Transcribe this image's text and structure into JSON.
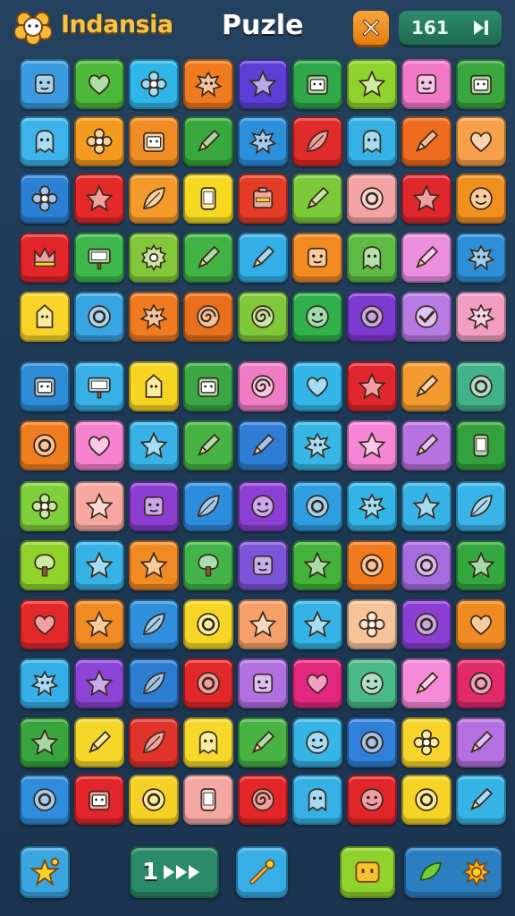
{
  "header": {
    "title_left": "Indansia",
    "title_center": "Puzle",
    "counter_value": "161",
    "logo_icon": "flower-badge-icon",
    "close_icon": "close-x-icon",
    "skip_icon": "skip-forward-icon"
  },
  "board": {
    "rows": [
      [
        [
          "#3a9be0",
          "square-face"
        ],
        [
          "#4cb83a",
          "heart"
        ],
        [
          "#2fb6e8",
          "flower"
        ],
        [
          "#f07a1f",
          "splat"
        ],
        [
          "#5b3fd6",
          "star"
        ],
        [
          "#2fa84a",
          "window-face"
        ],
        [
          "#8fd22c",
          "star"
        ],
        [
          "#f07ac8",
          "square-face"
        ],
        [
          "#39a63e",
          "window-face"
        ]
      ],
      [
        [
          "#3cb3ea",
          "ghost"
        ],
        [
          "#f39a1e",
          "flower"
        ],
        [
          "#f08c24",
          "window-face"
        ],
        [
          "#39a83c",
          "pencil"
        ],
        [
          "#2c8fdc",
          "splat"
        ],
        [
          "#e12a2a",
          "leaf"
        ],
        [
          "#35b1e6",
          "ghost"
        ],
        [
          "#ee6a1e",
          "pencil"
        ],
        [
          "#f7a04a",
          "heart"
        ]
      ],
      [
        [
          "#2c80d4",
          "flower"
        ],
        [
          "#e32a28",
          "star"
        ],
        [
          "#f49a2a",
          "leaf"
        ],
        [
          "#f7d921",
          "phone"
        ],
        [
          "#e33b25",
          "battery"
        ],
        [
          "#7cc93a",
          "pencil"
        ],
        [
          "#f4a3a3",
          "ring"
        ],
        [
          "#e0272d",
          "star"
        ],
        [
          "#f0901e",
          "face"
        ]
      ],
      [
        [
          "#e1252b",
          "crown"
        ],
        [
          "#3db94c",
          "sign"
        ],
        [
          "#82c83a",
          "gear"
        ],
        [
          "#41b445",
          "pencil"
        ],
        [
          "#34aee6",
          "pencil"
        ],
        [
          "#f28a22",
          "square-face"
        ],
        [
          "#5dbb44",
          "ghost"
        ],
        [
          "#ec8ee0",
          "pencil"
        ],
        [
          "#2e8fd8",
          "splat"
        ]
      ],
      [
        [
          "#f7d427",
          "tag"
        ],
        [
          "#39a4e2",
          "ring"
        ],
        [
          "#ef7a1f",
          "splat"
        ],
        [
          "#e8701d",
          "swirl"
        ],
        [
          "#7fc83a",
          "swirl"
        ],
        [
          "#2fb04a",
          "face"
        ],
        [
          "#7d3ad0",
          "ring"
        ],
        [
          "#b67be2",
          "check"
        ],
        [
          "#f29ec2",
          "splat"
        ]
      ],
      [
        [
          "#2e8cd8",
          "window-face"
        ],
        [
          "#36b0e6",
          "sign"
        ],
        [
          "#f6d422",
          "tag"
        ],
        [
          "#3ba744",
          "window-face"
        ],
        [
          "#f07cc6",
          "swirl"
        ],
        [
          "#32b6e8",
          "heart"
        ],
        [
          "#e2262e",
          "star"
        ],
        [
          "#f29a2e",
          "pencil"
        ],
        [
          "#42b28a",
          "ring"
        ]
      ],
      [
        [
          "#f07e20",
          "ring"
        ],
        [
          "#f482cf",
          "heart"
        ],
        [
          "#38b2e6",
          "star"
        ],
        [
          "#46b344",
          "pencil"
        ],
        [
          "#2f7ed6",
          "pencil"
        ],
        [
          "#36b6e4",
          "splat"
        ],
        [
          "#f685d6",
          "star"
        ],
        [
          "#b672e0",
          "pencil"
        ],
        [
          "#33a23e",
          "phone"
        ]
      ],
      [
        [
          "#7fcf3a",
          "flower"
        ],
        [
          "#f6a8a0",
          "star"
        ],
        [
          "#8b3ed0",
          "square-face"
        ],
        [
          "#2e8cdc",
          "leaf"
        ],
        [
          "#8b3fd3",
          "face"
        ],
        [
          "#2f9ee0",
          "ring"
        ],
        [
          "#33b4e6",
          "splat"
        ],
        [
          "#36b2e6",
          "star"
        ],
        [
          "#3ab4e8",
          "leaf"
        ]
      ],
      [
        [
          "#8fd22a",
          "tree"
        ],
        [
          "#36b2e6",
          "star"
        ],
        [
          "#f08a22",
          "star"
        ],
        [
          "#43b448",
          "tree"
        ],
        [
          "#7b54d8",
          "square-face"
        ],
        [
          "#43b23a",
          "star"
        ],
        [
          "#f07a1c",
          "ring"
        ],
        [
          "#a46ce0",
          "ring"
        ],
        [
          "#32a83e",
          "star"
        ]
      ],
      [
        [
          "#e3282c",
          "heart"
        ],
        [
          "#ef8a24",
          "star"
        ],
        [
          "#2f8fdc",
          "leaf"
        ],
        [
          "#f7d626",
          "ring"
        ],
        [
          "#f4a068",
          "star"
        ],
        [
          "#34b4e6",
          "star"
        ],
        [
          "#f6c39a",
          "flower"
        ],
        [
          "#8a3fd2",
          "ring"
        ],
        [
          "#ef8a22",
          "heart"
        ]
      ],
      [
        [
          "#35aee8",
          "splat"
        ],
        [
          "#8a44d6",
          "star"
        ],
        [
          "#2c7dd2",
          "leaf"
        ],
        [
          "#e2282a",
          "ring"
        ],
        [
          "#b070e0",
          "square-face"
        ],
        [
          "#e4277e",
          "heart"
        ],
        [
          "#49b98a",
          "face"
        ],
        [
          "#f58ad8",
          "pencil"
        ],
        [
          "#e02a6a",
          "ring"
        ]
      ],
      [
        [
          "#38a63c",
          "star"
        ],
        [
          "#f6d628",
          "pencil"
        ],
        [
          "#e0332a",
          "leaf"
        ],
        [
          "#f7d82a",
          "ghost"
        ],
        [
          "#48b343",
          "pencil"
        ],
        [
          "#36b4e6",
          "face"
        ],
        [
          "#2f80d8",
          "ring"
        ],
        [
          "#f6d42a",
          "flower"
        ],
        [
          "#b370e0",
          "pencil"
        ]
      ],
      [
        [
          "#2e8edc",
          "ring"
        ],
        [
          "#e2262c",
          "window-face"
        ],
        [
          "#f6d024",
          "ring"
        ],
        [
          "#f4a8a4",
          "phone"
        ],
        [
          "#e3262a",
          "swirl"
        ],
        [
          "#36b0e6",
          "ghost"
        ],
        [
          "#e1262a",
          "face"
        ],
        [
          "#f6d426",
          "ring"
        ],
        [
          "#36b2e6",
          "pencil"
        ]
      ]
    ]
  },
  "footer": {
    "level_label": "1",
    "star_icon": "star-bell-icon",
    "play_icon": "fast-forward-icon",
    "wand_icon": "magic-wand-icon",
    "box_icon": "smiley-box-icon",
    "leaf_icon": "leaf-icon",
    "sun_icon": "sun-icon"
  }
}
